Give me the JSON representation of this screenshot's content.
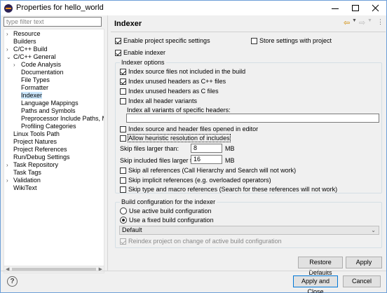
{
  "window": {
    "title": "Properties for hello_world"
  },
  "filter": {
    "placeholder": "type filter text"
  },
  "tree": [
    {
      "label": "Resource",
      "arrow": "›"
    },
    {
      "label": "Builders",
      "arrow": ""
    },
    {
      "label": "C/C++ Build",
      "arrow": "›"
    },
    {
      "label": "C/C++ General",
      "arrow": "⌄"
    },
    {
      "label": "Code Analysis",
      "arrow": "›"
    },
    {
      "label": "Documentation",
      "arrow": ""
    },
    {
      "label": "File Types",
      "arrow": ""
    },
    {
      "label": "Formatter",
      "arrow": ""
    },
    {
      "label": "Indexer",
      "arrow": "",
      "selected": true
    },
    {
      "label": "Language Mappings",
      "arrow": ""
    },
    {
      "label": "Paths and Symbols",
      "arrow": ""
    },
    {
      "label": "Preprocessor Include Paths, Macros",
      "arrow": ""
    },
    {
      "label": "Profiling Categories",
      "arrow": ""
    },
    {
      "label": "Linux Tools Path",
      "arrow": ""
    },
    {
      "label": "Project Natures",
      "arrow": ""
    },
    {
      "label": "Project References",
      "arrow": ""
    },
    {
      "label": "Run/Debug Settings",
      "arrow": ""
    },
    {
      "label": "Task Repository",
      "arrow": "›"
    },
    {
      "label": "Task Tags",
      "arrow": ""
    },
    {
      "label": "Validation",
      "arrow": "›"
    },
    {
      "label": "WikiText",
      "arrow": ""
    }
  ],
  "page": {
    "title": "Indexer",
    "enable_project_specific": "Enable project specific settings",
    "store_settings": "Store settings with project",
    "enable_indexer": "Enable indexer",
    "indexer_options": {
      "title": "Indexer options",
      "index_source_not_included": "Index source files not included in the build",
      "index_unused_cpp": "Index unused headers as C++ files",
      "index_unused_c": "Index unused headers as C files",
      "index_all_header_variants": "Index all header variants",
      "index_specific_headers_label": "Index all variants of specific headers:",
      "index_specific_headers_value": "",
      "index_opened_in_editor": "Index source and header files opened in editor",
      "allow_heuristic": "Allow heuristic resolution of includes",
      "skip_larger_label": "Skip files larger than:",
      "skip_larger_value": "8",
      "skip_larger_unit": "MB",
      "skip_included_label": "Skip included files larger than:",
      "skip_included_value": "16",
      "skip_included_unit": "MB",
      "skip_all_refs": "Skip all references (Call Hierarchy and Search will not work)",
      "skip_implicit_refs": "Skip implicit references (e.g. overloaded operators)",
      "skip_type_macro_refs": "Skip type and macro references (Search for these references will not work)"
    },
    "build_config": {
      "title": "Build configuration for the indexer",
      "use_active": "Use active build configuration",
      "use_fixed": "Use a fixed build configuration",
      "fixed_value": "Default",
      "reindex": "Reindex project on change of active build configuration"
    }
  },
  "buttons": {
    "restore_defaults": "Restore Defaults",
    "apply": "Apply",
    "apply_and_close": "Apply and Close",
    "cancel": "Cancel"
  }
}
